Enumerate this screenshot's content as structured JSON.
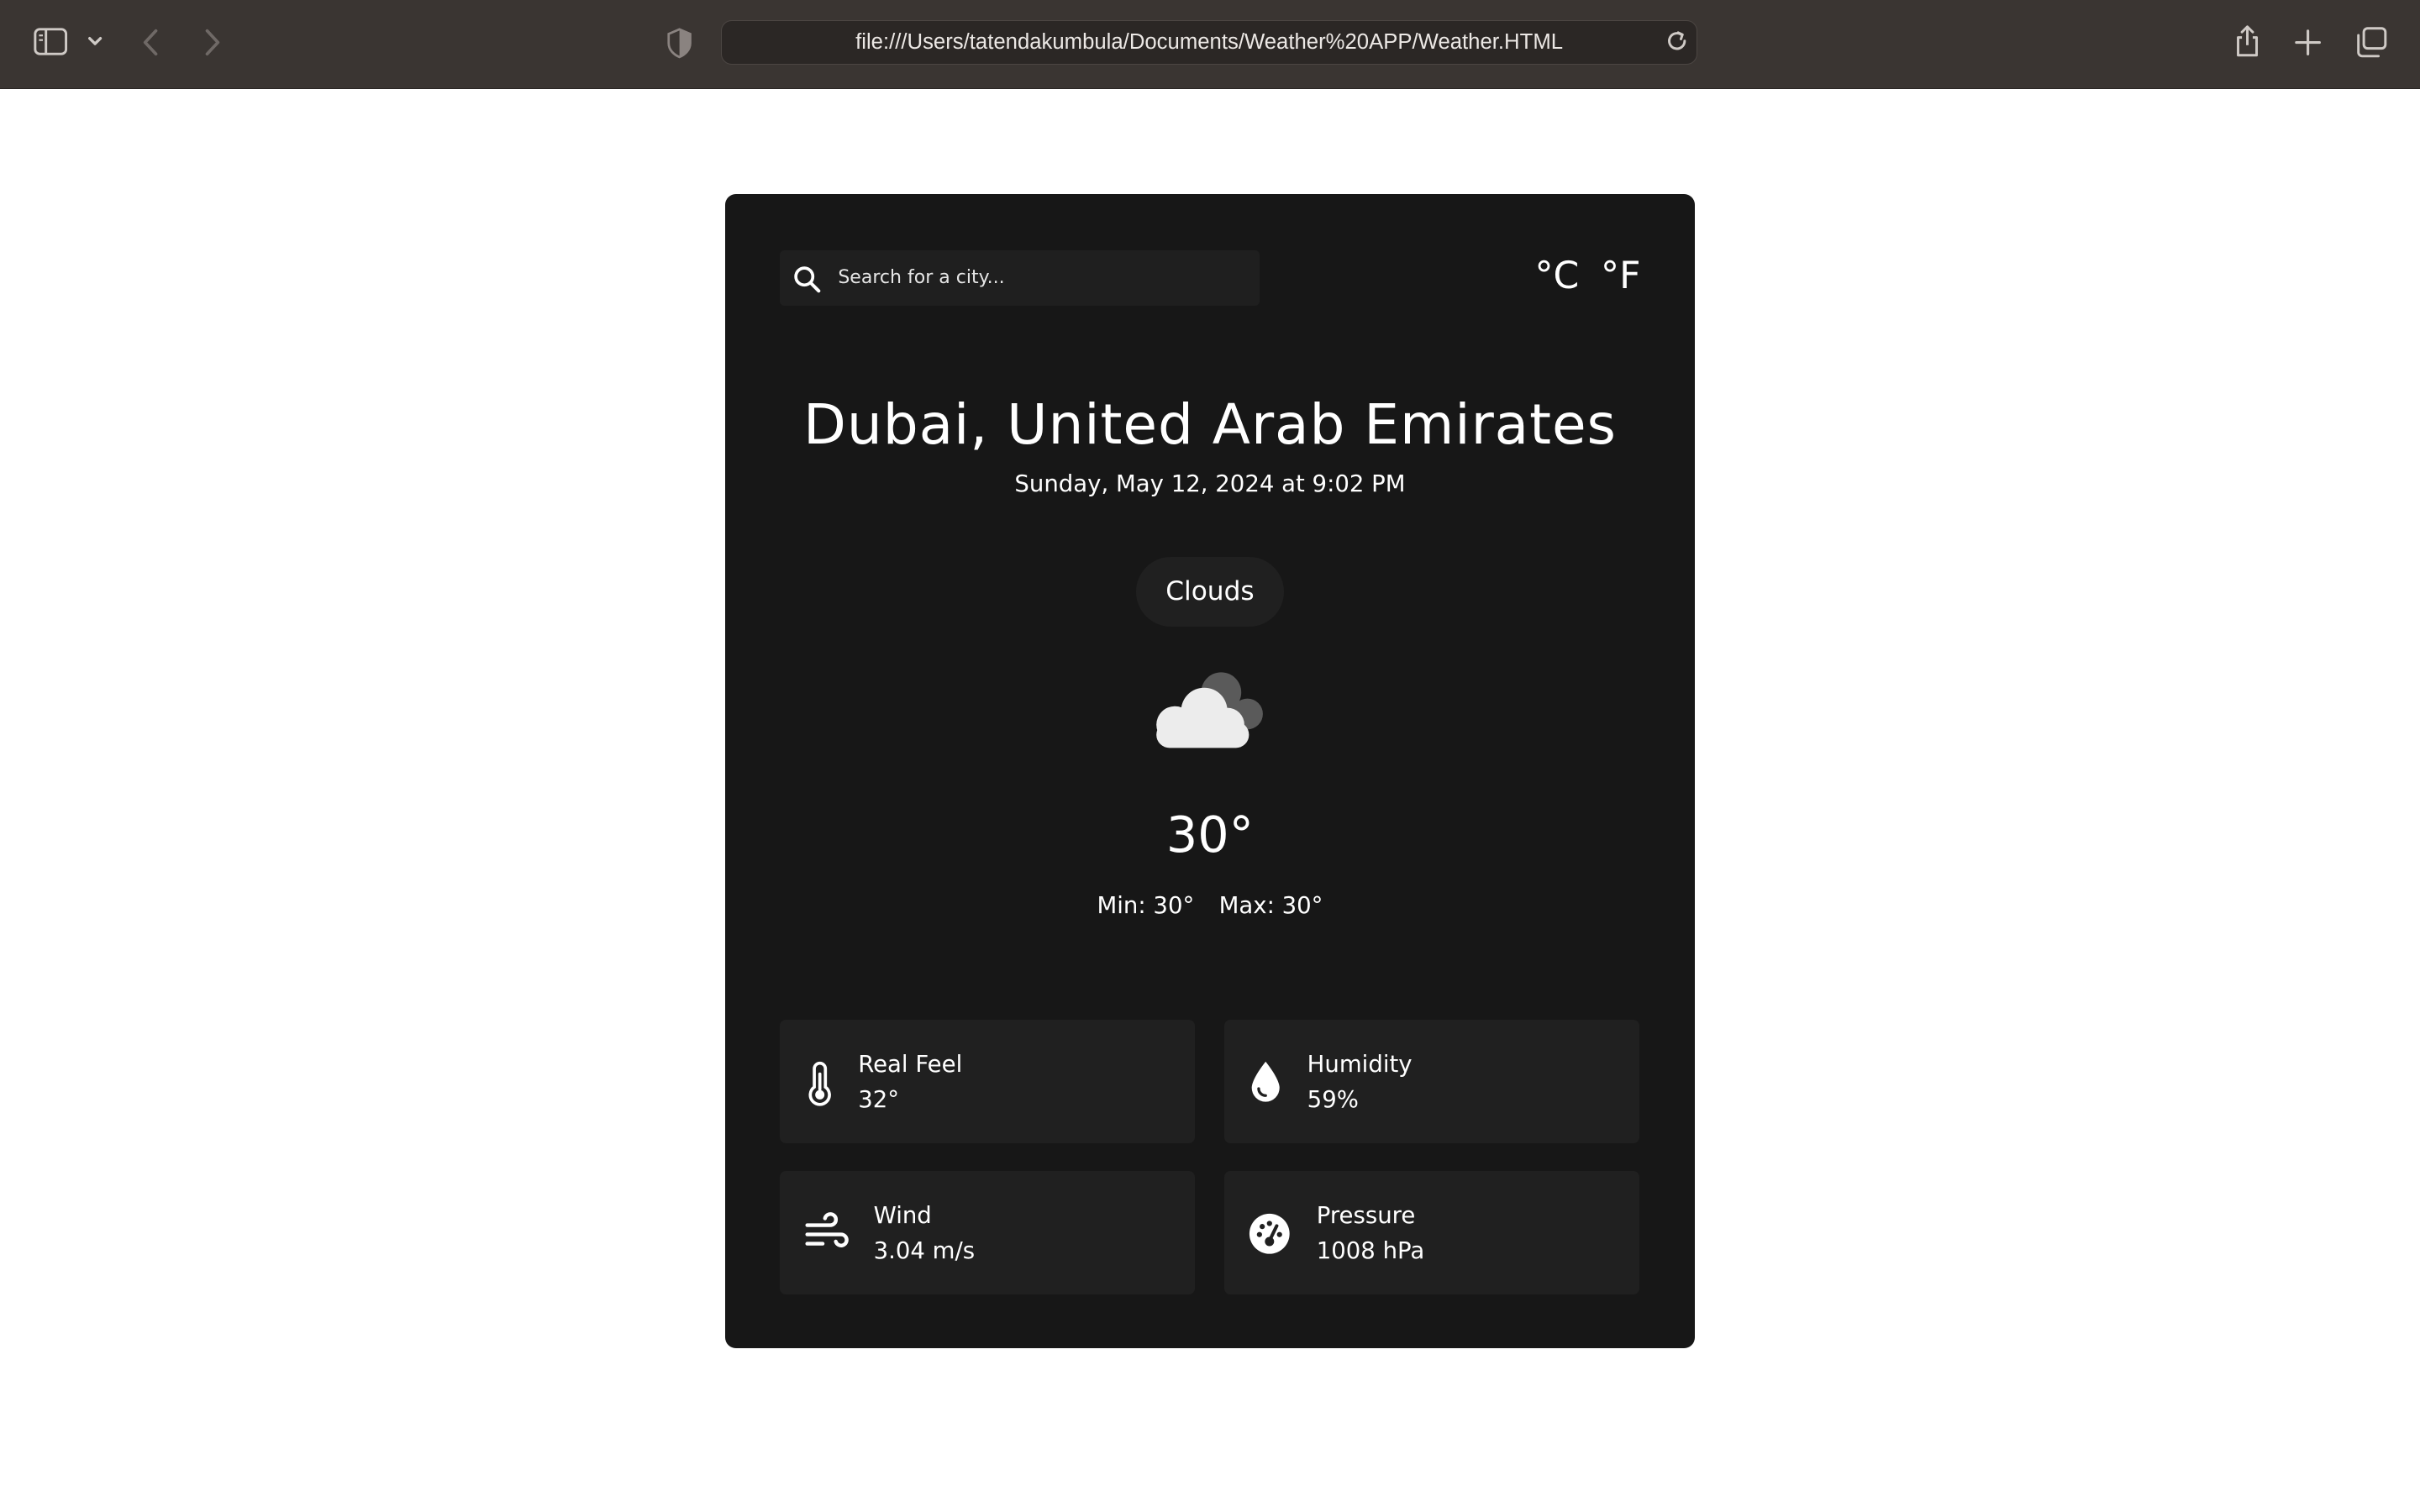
{
  "browser": {
    "url": "file:///Users/tatendakumbula/Documents/Weather%20APP/Weather.HTML",
    "icons": [
      "sidebar-icon",
      "chevron-down-icon",
      "back-icon",
      "forward-icon",
      "shield-icon",
      "reload-icon",
      "share-icon",
      "plus-icon",
      "tabs-icon"
    ]
  },
  "search": {
    "placeholder": "Search for a city..."
  },
  "units": {
    "celsius": "°C",
    "fahrenheit": "°F"
  },
  "location": {
    "city": "Dubai, United Arab Emirates",
    "datetime": "Sunday, May 12, 2024 at 9:02 PM"
  },
  "current": {
    "condition": "Clouds",
    "icon": "clouds-icon",
    "temperature": "30°",
    "min": "Min: 30°",
    "max": "Max: 30°"
  },
  "stats": {
    "real_feel": {
      "label": "Real Feel",
      "value": "32°",
      "icon": "thermometer-icon"
    },
    "humidity": {
      "label": "Humidity",
      "value": "59%",
      "icon": "droplet-icon"
    },
    "wind": {
      "label": "Wind",
      "value": "3.04 m/s",
      "icon": "wind-icon"
    },
    "pressure": {
      "label": "Pressure",
      "value": "1008 hPa",
      "icon": "gauge-icon"
    }
  },
  "colors": {
    "card_background": "#171717",
    "tile_background": "#202020",
    "text": "#ffffff",
    "browser_toolbar": "#3a3532"
  }
}
